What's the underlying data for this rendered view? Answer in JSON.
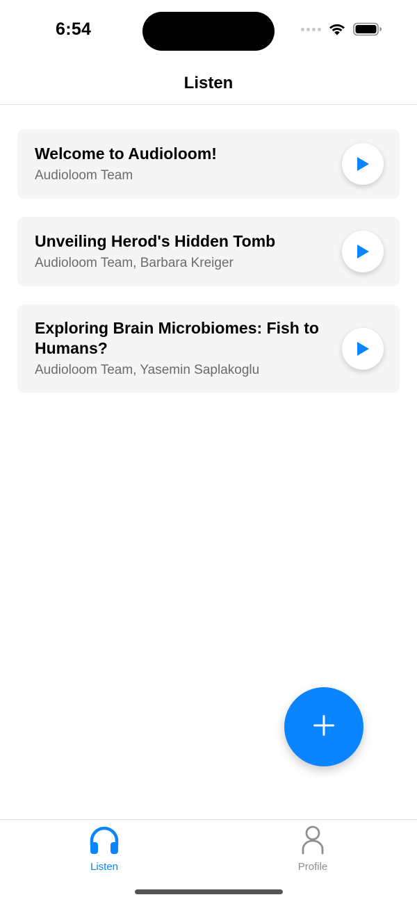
{
  "status_bar": {
    "time": "6:54"
  },
  "header": {
    "title": "Listen"
  },
  "episodes": [
    {
      "title": "Welcome to Audioloom!",
      "authors": "Audioloom Team"
    },
    {
      "title": "Unveiling Herod's Hidden Tomb",
      "authors": "Audioloom Team, Barbara Kreiger"
    },
    {
      "title": "Exploring Brain Microbiomes: Fish to Humans?",
      "authors": "Audioloom Team, Yasemin Saplakoglu"
    }
  ],
  "tabs": [
    {
      "label": "Listen",
      "icon": "headphones-icon",
      "active": true
    },
    {
      "label": "Profile",
      "icon": "person-icon",
      "active": false
    }
  ],
  "colors": {
    "accent": "#0a84ff",
    "card_background": "#f5f5f6",
    "secondary_text": "#6b6b6b",
    "inactive_tab": "#8e8e93"
  },
  "icons": {
    "play": "play-icon",
    "add": "plus-icon",
    "wifi": "wifi-icon",
    "battery": "battery-icon",
    "signal": "cellular-signal-icon"
  }
}
